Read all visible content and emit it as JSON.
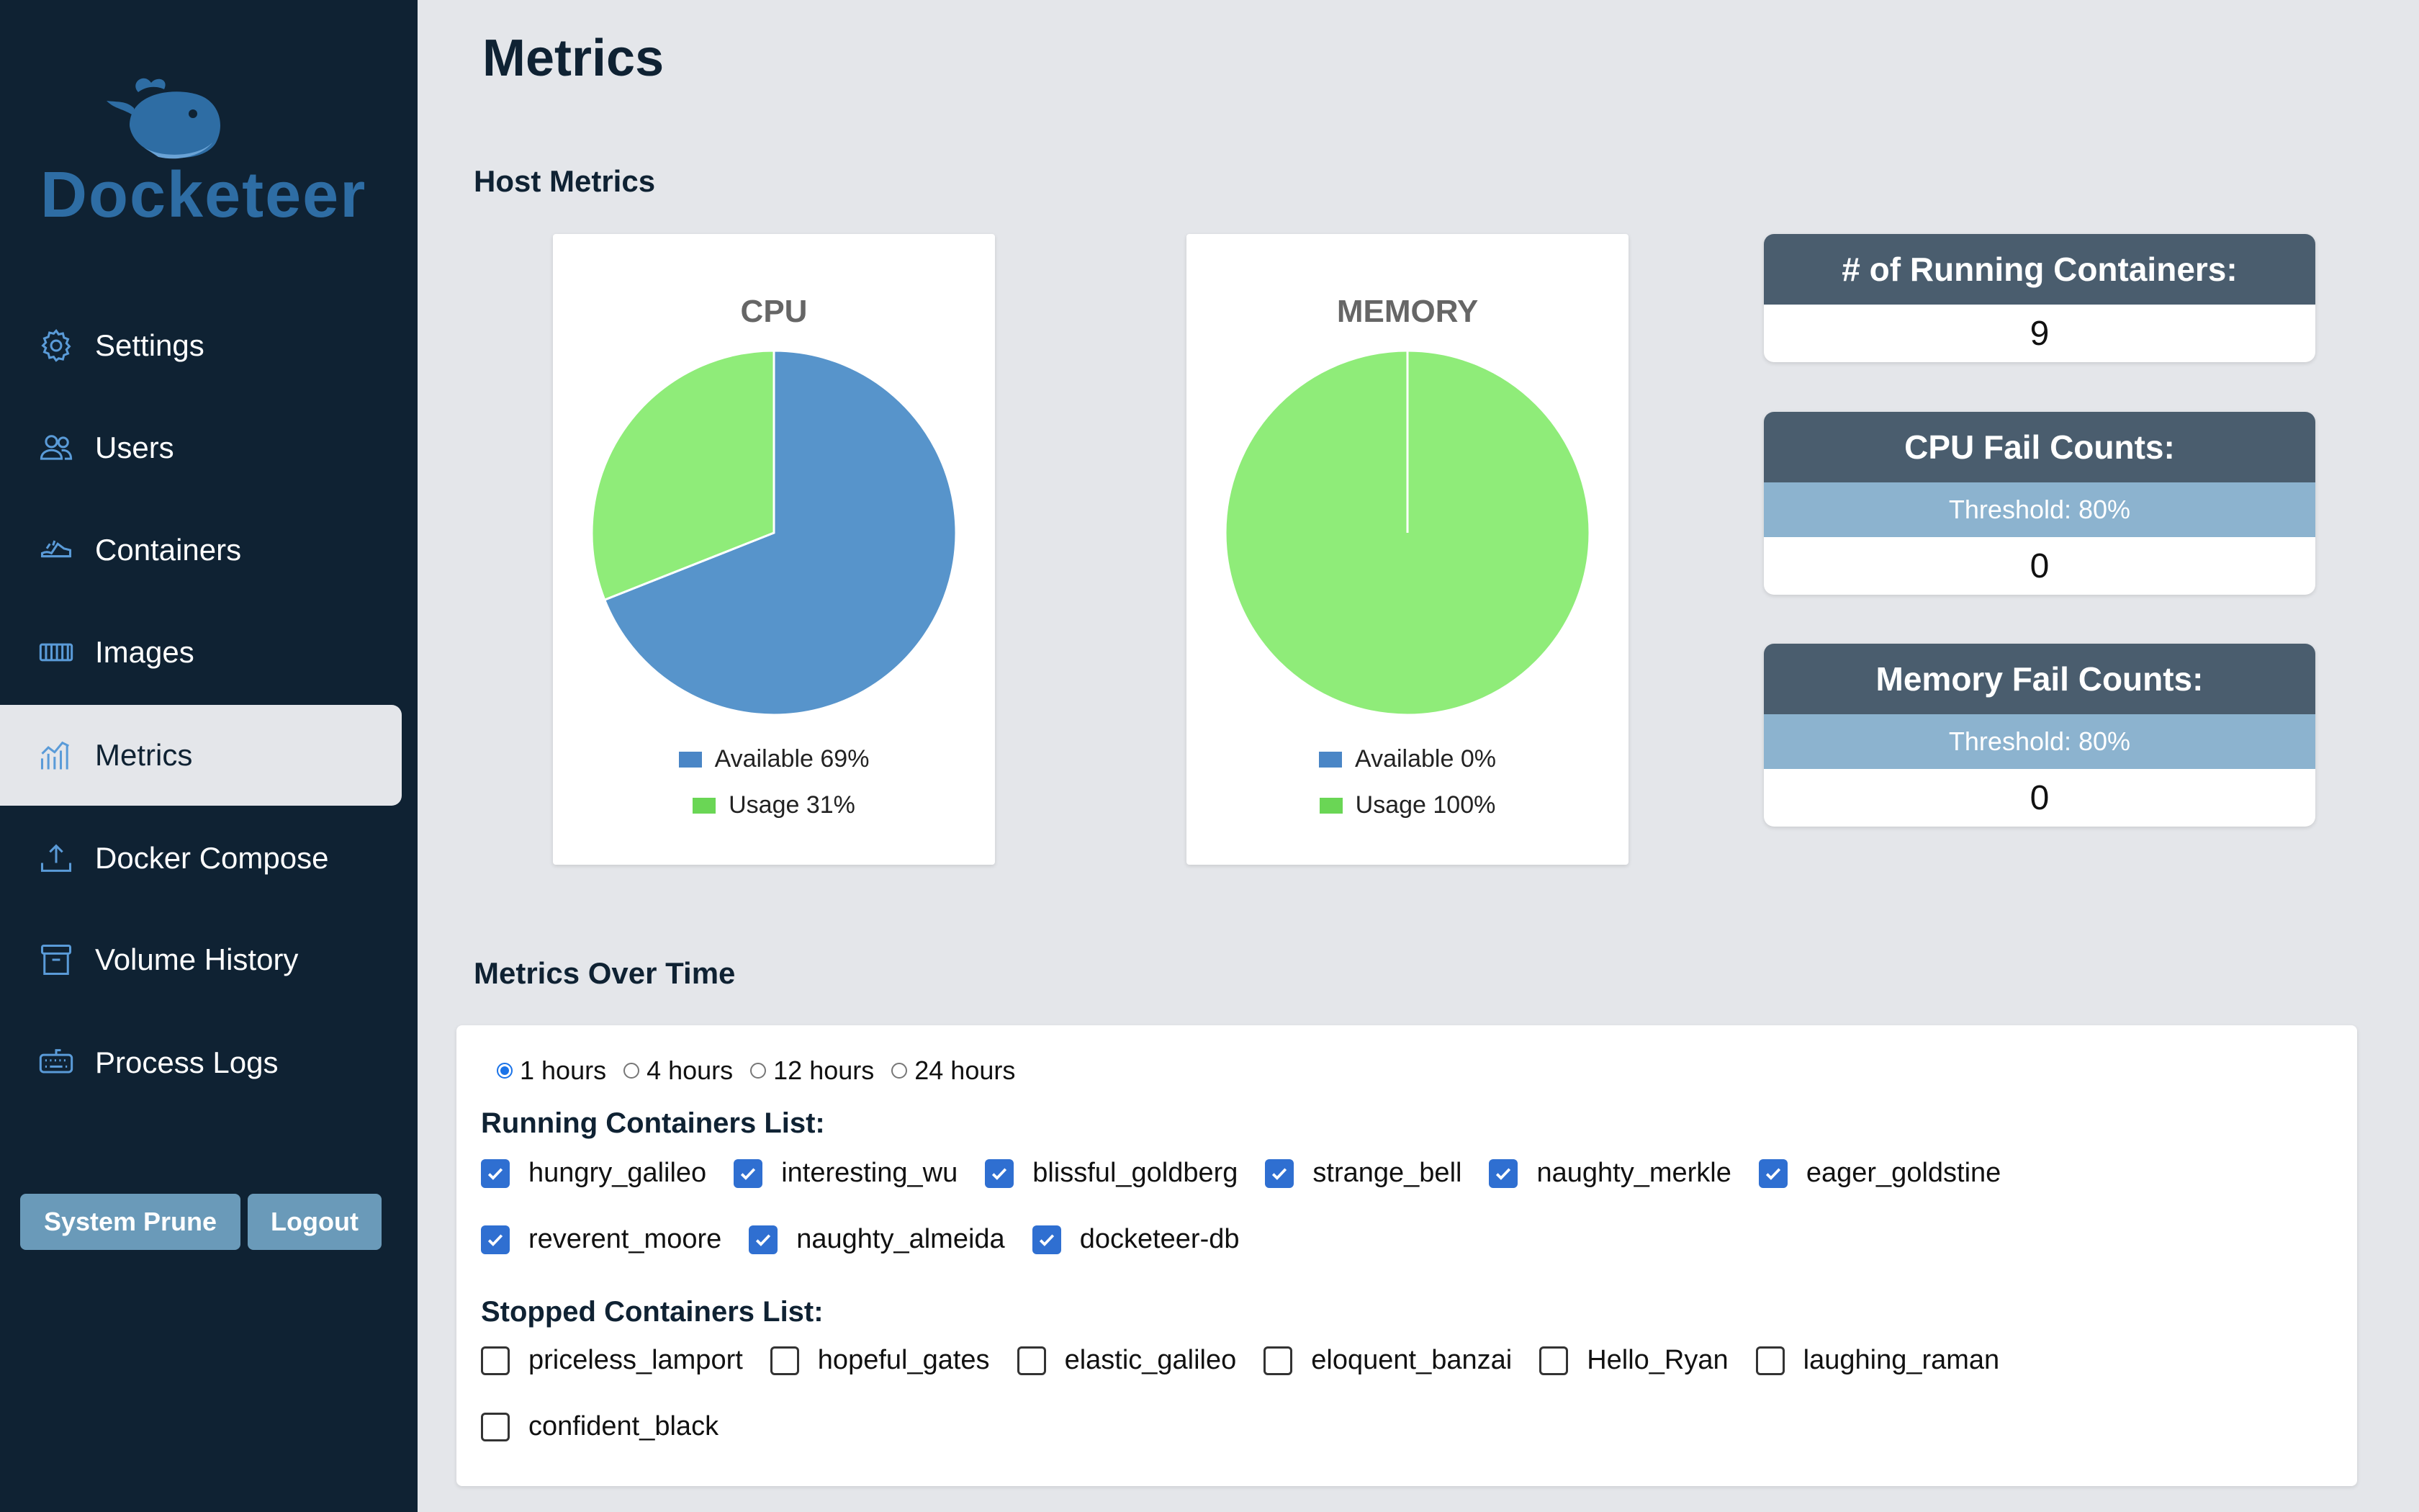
{
  "app": {
    "name": "Docketeer"
  },
  "sidebar": {
    "items": [
      {
        "label": "Settings",
        "icon": "gear-icon"
      },
      {
        "label": "Users",
        "icon": "users-icon"
      },
      {
        "label": "Containers",
        "icon": "containers-icon"
      },
      {
        "label": "Images",
        "icon": "images-icon"
      },
      {
        "label": "Metrics",
        "icon": "chart-icon",
        "active": true
      },
      {
        "label": "Docker Compose",
        "icon": "upload-icon"
      },
      {
        "label": "Volume History",
        "icon": "archive-icon"
      },
      {
        "label": "Process Logs",
        "icon": "keyboard-icon"
      }
    ],
    "system_prune_label": "System Prune",
    "logout_label": "Logout"
  },
  "page": {
    "title": "Metrics",
    "host_metrics_title": "Host Metrics",
    "metrics_over_time_title": "Metrics Over Time"
  },
  "chart_data": [
    {
      "type": "pie",
      "title": "CPU",
      "categories": [
        "Available 69%",
        "Usage 31%"
      ],
      "values": [
        69,
        31
      ],
      "colors": [
        "#5794cb",
        "#8fec79"
      ],
      "legend": "bottom"
    },
    {
      "type": "pie",
      "title": "MEMORY",
      "categories": [
        "Available 0%",
        "Usage 100%"
      ],
      "values": [
        0,
        100
      ],
      "colors": [
        "#5794cb",
        "#8fec79"
      ],
      "legend": "bottom"
    }
  ],
  "stats": {
    "running": {
      "title": "# of Running Containers:",
      "value": "9"
    },
    "cpu_fail": {
      "title": "CPU Fail Counts:",
      "threshold": "Threshold: 80%",
      "value": "0"
    },
    "mem_fail": {
      "title": "Memory Fail Counts:",
      "threshold": "Threshold: 80%",
      "value": "0"
    }
  },
  "metrics_over_time": {
    "time_options": [
      {
        "label": "1 hours",
        "selected": true
      },
      {
        "label": "4 hours",
        "selected": false
      },
      {
        "label": "12 hours",
        "selected": false
      },
      {
        "label": "24 hours",
        "selected": false
      }
    ],
    "running_title": "Running Containers List:",
    "running": [
      "hungry_galileo",
      "interesting_wu",
      "blissful_goldberg",
      "strange_bell",
      "naughty_merkle",
      "eager_goldstine",
      "reverent_moore",
      "naughty_almeida",
      "docketeer-db"
    ],
    "stopped_title": "Stopped Containers List:",
    "stopped": [
      "priceless_lamport",
      "hopeful_gates",
      "elastic_galileo",
      "eloquent_banzai",
      "Hello_Ryan",
      "laughing_raman",
      "confident_black"
    ]
  },
  "colors": {
    "sidebar_bg": "#0f2233",
    "accent_blue": "#2e6da4",
    "available": "#5794cb",
    "usage": "#8fec79",
    "stat_header": "#4a5d6e",
    "threshold_bg": "#8cb3cf",
    "checkbox": "#2f6fd1"
  }
}
